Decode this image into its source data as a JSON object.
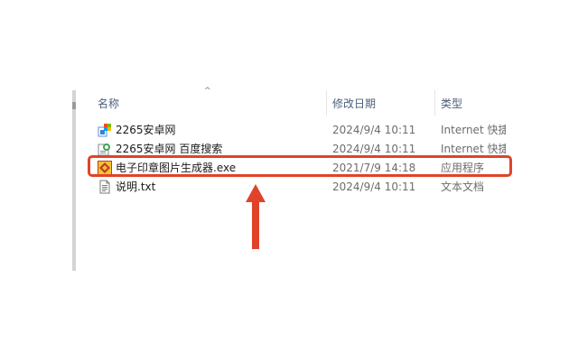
{
  "columns": {
    "name": "名称",
    "date": "修改日期",
    "type": "类型"
  },
  "sort_indicator": "^",
  "files": [
    {
      "name": "2265安卓网",
      "date": "2024/9/4 10:11",
      "type": "Internet 快捷方式",
      "icon": "internet-shortcut-icon"
    },
    {
      "name": "2265安卓网 百度搜索",
      "date": "2024/9/4 10:11",
      "type": "Internet 快捷方式",
      "icon": "internet-shortcut-icon"
    },
    {
      "name": "电子印章图片生成器.exe",
      "date": "2021/7/9 14:18",
      "type": "应用程序",
      "icon": "application-icon"
    },
    {
      "name": "说明.txt",
      "date": "2024/9/4 10:11",
      "type": "文本文档",
      "icon": "text-document-icon"
    }
  ],
  "colors": {
    "highlight": "#e0432a",
    "header_text": "#4c607a",
    "meta_text": "#6d6d6d"
  }
}
